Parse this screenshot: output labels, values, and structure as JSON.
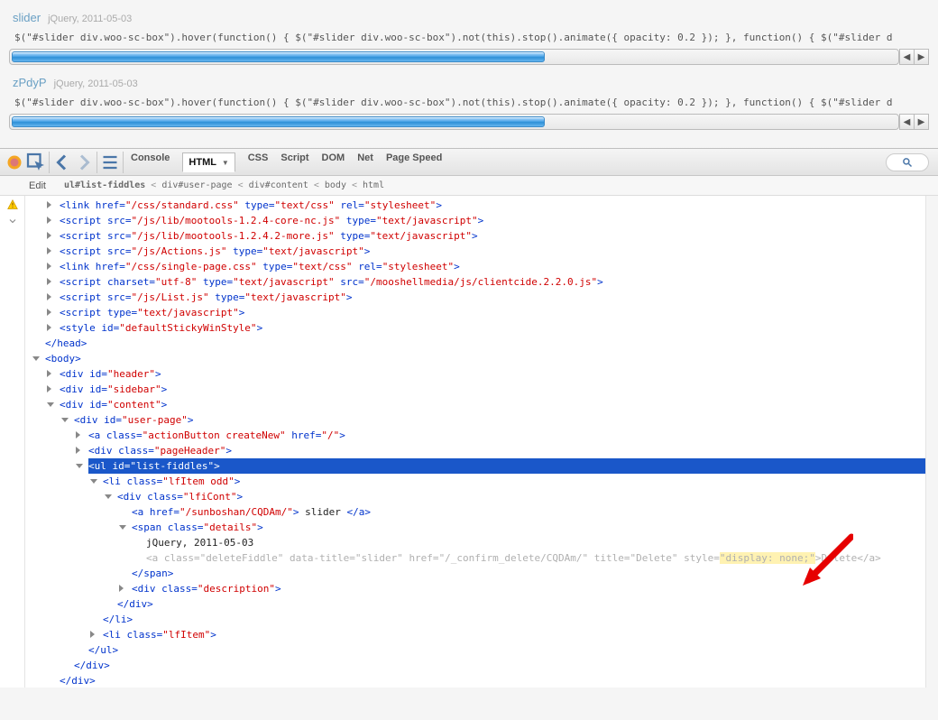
{
  "top": {
    "items": [
      {
        "title": "slider",
        "meta": "jQuery, 2011-05-03",
        "code": "$(\"#slider div.woo-sc-box\").hover(function() { $(\"#slider div.woo-sc-box\").not(this).stop().animate({ opacity: 0.2 }); }, function() { $(\"#slider d",
        "progress": 60
      },
      {
        "title": "zPdyP",
        "meta": "jQuery, 2011-05-03",
        "code": "$(\"#slider div.woo-sc-box\").hover(function() { $(\"#slider div.woo-sc-box\").not(this).stop().animate({ opacity: 0.2 }); }, function() { $(\"#slider d",
        "progress": 60
      }
    ]
  },
  "toolbar": {
    "tabs": [
      "Console",
      "HTML",
      "CSS",
      "Script",
      "DOM",
      "Net",
      "Page Speed"
    ],
    "active_index": 1
  },
  "subbar": {
    "edit": "Edit",
    "crumbs": [
      "ul#list-fiddles",
      "div#user-page",
      "div#content",
      "body",
      "html"
    ]
  },
  "tree": {
    "nodes": [
      {
        "d": 2,
        "exp": "collapsed",
        "t": [
          [
            "p",
            "<link "
          ],
          [
            "an",
            "href="
          ],
          [
            "av",
            "\"/css/standard.css\""
          ],
          [
            "p",
            " "
          ],
          [
            "an",
            "type="
          ],
          [
            "av",
            "\"text/css\""
          ],
          [
            "p",
            " "
          ],
          [
            "an",
            "rel="
          ],
          [
            "av",
            "\"stylesheet\""
          ],
          [
            "p",
            ">"
          ]
        ]
      },
      {
        "d": 2,
        "exp": "collapsed",
        "t": [
          [
            "p",
            "<script "
          ],
          [
            "an",
            "src="
          ],
          [
            "av",
            "\"/js/lib/mootools-1.2.4-core-nc.js\""
          ],
          [
            "p",
            " "
          ],
          [
            "an",
            "type="
          ],
          [
            "av",
            "\"text/javascript\""
          ],
          [
            "p",
            ">"
          ]
        ]
      },
      {
        "d": 2,
        "exp": "collapsed",
        "t": [
          [
            "p",
            "<script "
          ],
          [
            "an",
            "src="
          ],
          [
            "av",
            "\"/js/lib/mootools-1.2.4.2-more.js\""
          ],
          [
            "p",
            " "
          ],
          [
            "an",
            "type="
          ],
          [
            "av",
            "\"text/javascript\""
          ],
          [
            "p",
            ">"
          ]
        ]
      },
      {
        "d": 2,
        "exp": "collapsed",
        "t": [
          [
            "p",
            "<script "
          ],
          [
            "an",
            "src="
          ],
          [
            "av",
            "\"/js/Actions.js\""
          ],
          [
            "p",
            " "
          ],
          [
            "an",
            "type="
          ],
          [
            "av",
            "\"text/javascript\""
          ],
          [
            "p",
            ">"
          ]
        ]
      },
      {
        "d": 2,
        "exp": "collapsed",
        "t": [
          [
            "p",
            "<link "
          ],
          [
            "an",
            "href="
          ],
          [
            "av",
            "\"/css/single-page.css\""
          ],
          [
            "p",
            " "
          ],
          [
            "an",
            "type="
          ],
          [
            "av",
            "\"text/css\""
          ],
          [
            "p",
            " "
          ],
          [
            "an",
            "rel="
          ],
          [
            "av",
            "\"stylesheet\""
          ],
          [
            "p",
            ">"
          ]
        ]
      },
      {
        "d": 2,
        "exp": "collapsed",
        "t": [
          [
            "p",
            "<script "
          ],
          [
            "an",
            "charset="
          ],
          [
            "av",
            "\"utf-8\""
          ],
          [
            "p",
            " "
          ],
          [
            "an",
            "type="
          ],
          [
            "av",
            "\"text/javascript\""
          ],
          [
            "p",
            " "
          ],
          [
            "an",
            "src="
          ],
          [
            "av",
            "\"/mooshellmedia/js/clientcide.2.2.0.js\""
          ],
          [
            "p",
            ">"
          ]
        ]
      },
      {
        "d": 2,
        "exp": "collapsed",
        "t": [
          [
            "p",
            "<script "
          ],
          [
            "an",
            "src="
          ],
          [
            "av",
            "\"/js/List.js\""
          ],
          [
            "p",
            " "
          ],
          [
            "an",
            "type="
          ],
          [
            "av",
            "\"text/javascript\""
          ],
          [
            "p",
            ">"
          ]
        ]
      },
      {
        "d": 2,
        "exp": "collapsed",
        "t": [
          [
            "p",
            "<script "
          ],
          [
            "an",
            "type="
          ],
          [
            "av",
            "\"text/javascript\""
          ],
          [
            "p",
            ">"
          ]
        ]
      },
      {
        "d": 2,
        "exp": "collapsed",
        "t": [
          [
            "p",
            "<style "
          ],
          [
            "an",
            "id="
          ],
          [
            "av",
            "\"defaultStickyWinStyle\""
          ],
          [
            "p",
            ">"
          ]
        ]
      },
      {
        "d": 1,
        "exp": "",
        "t": [
          [
            "p",
            "</head>"
          ]
        ]
      },
      {
        "d": 1,
        "exp": "expanded",
        "t": [
          [
            "p",
            "<body>"
          ]
        ]
      },
      {
        "d": 2,
        "exp": "collapsed",
        "t": [
          [
            "p",
            "<div "
          ],
          [
            "an",
            "id="
          ],
          [
            "av",
            "\"header\""
          ],
          [
            "p",
            ">"
          ]
        ]
      },
      {
        "d": 2,
        "exp": "collapsed",
        "t": [
          [
            "p",
            "<div "
          ],
          [
            "an",
            "id="
          ],
          [
            "av",
            "\"sidebar\""
          ],
          [
            "p",
            ">"
          ]
        ]
      },
      {
        "d": 2,
        "exp": "expanded",
        "t": [
          [
            "p",
            "<div "
          ],
          [
            "an",
            "id="
          ],
          [
            "av",
            "\"content\""
          ],
          [
            "p",
            ">"
          ]
        ]
      },
      {
        "d": 3,
        "exp": "expanded",
        "t": [
          [
            "p",
            "<div "
          ],
          [
            "an",
            "id="
          ],
          [
            "av",
            "\"user-page\""
          ],
          [
            "p",
            ">"
          ]
        ]
      },
      {
        "d": 4,
        "exp": "collapsed",
        "t": [
          [
            "p",
            "<a "
          ],
          [
            "an",
            "class="
          ],
          [
            "av",
            "\"actionButton createNew\""
          ],
          [
            "p",
            " "
          ],
          [
            "an",
            "href="
          ],
          [
            "av",
            "\"/\""
          ],
          [
            "p",
            ">"
          ]
        ]
      },
      {
        "d": 4,
        "exp": "collapsed",
        "t": [
          [
            "p",
            "<div "
          ],
          [
            "an",
            "class="
          ],
          [
            "av",
            "\"pageHeader\""
          ],
          [
            "p",
            ">"
          ]
        ]
      },
      {
        "d": 4,
        "exp": "expanded",
        "hl": true,
        "t": [
          [
            "p",
            "<ul "
          ],
          [
            "an",
            "id="
          ],
          [
            "av",
            "\"list-fiddles\""
          ],
          [
            "p",
            ">"
          ]
        ]
      },
      {
        "d": 5,
        "exp": "expanded",
        "t": [
          [
            "p",
            "<li "
          ],
          [
            "an",
            "class="
          ],
          [
            "av",
            "\"lfItem odd\""
          ],
          [
            "p",
            ">"
          ]
        ]
      },
      {
        "d": 6,
        "exp": "expanded",
        "t": [
          [
            "p",
            "<div "
          ],
          [
            "an",
            "class="
          ],
          [
            "av",
            "\"lfiCont\""
          ],
          [
            "p",
            ">"
          ]
        ]
      },
      {
        "d": 7,
        "exp": "",
        "t": [
          [
            "p",
            "<a "
          ],
          [
            "an",
            "href="
          ],
          [
            "av",
            "\"/sunboshan/CQDAm/\""
          ],
          [
            "p",
            "> "
          ],
          [
            "txt",
            "slider "
          ],
          [
            "p",
            "</a>"
          ]
        ]
      },
      {
        "d": 7,
        "exp": "expanded",
        "t": [
          [
            "p",
            "<span "
          ],
          [
            "an",
            "class="
          ],
          [
            "av",
            "\"details\""
          ],
          [
            "p",
            ">"
          ]
        ]
      },
      {
        "d": 8,
        "exp": "",
        "t": [
          [
            "txt",
            "jQuery, 2011-05-03"
          ]
        ]
      },
      {
        "d": 8,
        "exp": "",
        "low": true,
        "t": [
          [
            "p",
            "<a "
          ],
          [
            "an",
            "class="
          ],
          [
            "av",
            "\"deleteFiddle\""
          ],
          [
            "p",
            " "
          ],
          [
            "an",
            "data-title="
          ],
          [
            "av",
            "\"slider\""
          ],
          [
            "p",
            " "
          ],
          [
            "an",
            "href="
          ],
          [
            "av",
            "\"/_confirm_delete/CQDAm/\""
          ],
          [
            "p",
            " "
          ],
          [
            "an",
            "title="
          ],
          [
            "av",
            "\"Delete\""
          ],
          [
            "p",
            " "
          ],
          [
            "an",
            "style="
          ],
          [
            "avY",
            "\"display: none;\""
          ],
          [
            "p",
            ">"
          ],
          [
            "txt",
            "Delete"
          ],
          [
            "p",
            "</a>"
          ]
        ]
      },
      {
        "d": 7,
        "exp": "",
        "t": [
          [
            "p",
            "</span>"
          ]
        ]
      },
      {
        "d": 7,
        "exp": "collapsed",
        "t": [
          [
            "p",
            "<div "
          ],
          [
            "an",
            "class="
          ],
          [
            "av",
            "\"description\""
          ],
          [
            "p",
            ">"
          ]
        ]
      },
      {
        "d": 6,
        "exp": "",
        "t": [
          [
            "p",
            "</div>"
          ]
        ]
      },
      {
        "d": 5,
        "exp": "",
        "t": [
          [
            "p",
            "</li>"
          ]
        ]
      },
      {
        "d": 5,
        "exp": "collapsed",
        "t": [
          [
            "p",
            "<li "
          ],
          [
            "an",
            "class="
          ],
          [
            "av",
            "\"lfItem\""
          ],
          [
            "p",
            ">"
          ]
        ]
      },
      {
        "d": 4,
        "exp": "",
        "t": [
          [
            "p",
            "</ul>"
          ]
        ]
      },
      {
        "d": 3,
        "exp": "",
        "t": [
          [
            "p",
            "</div>"
          ]
        ]
      },
      {
        "d": 2,
        "exp": "",
        "t": [
          [
            "p",
            "</div>"
          ]
        ]
      }
    ]
  }
}
